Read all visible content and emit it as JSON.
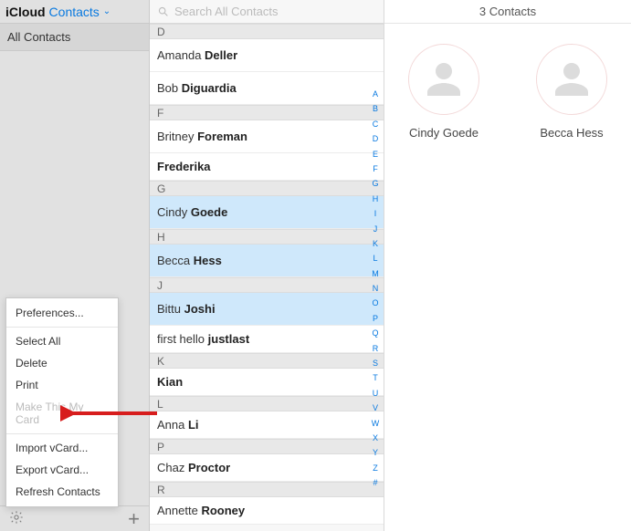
{
  "header": {
    "brand": "iCloud",
    "section": "Contacts"
  },
  "sidebar": {
    "groups": [
      {
        "label": "All Contacts"
      }
    ]
  },
  "search": {
    "placeholder": "Search All Contacts"
  },
  "alpha_index": [
    "A",
    "B",
    "C",
    "D",
    "E",
    "F",
    "G",
    "H",
    "I",
    "J",
    "K",
    "L",
    "M",
    "N",
    "O",
    "P",
    "Q",
    "R",
    "S",
    "T",
    "U",
    "V",
    "W",
    "X",
    "Y",
    "Z",
    "#"
  ],
  "popup": {
    "items": [
      {
        "label": "Preferences...",
        "disabled": false
      },
      {
        "sep": true
      },
      {
        "label": "Select All",
        "disabled": false
      },
      {
        "label": "Delete",
        "disabled": false
      },
      {
        "label": "Print",
        "disabled": false
      },
      {
        "label": "Make This My Card",
        "disabled": true
      },
      {
        "sep": true
      },
      {
        "label": "Import vCard...",
        "disabled": false
      },
      {
        "label": "Export vCard...",
        "disabled": false
      },
      {
        "label": "Refresh Contacts",
        "disabled": false
      }
    ]
  },
  "list": [
    {
      "type": "header",
      "label": "D"
    },
    {
      "type": "contact",
      "first": "Amanda ",
      "last": "Deller",
      "selected": false,
      "slim": false
    },
    {
      "type": "contact",
      "first": "Bob ",
      "last": "Diguardia",
      "selected": false,
      "slim": false
    },
    {
      "type": "header",
      "label": "F"
    },
    {
      "type": "contact",
      "first": "Britney ",
      "last": "Foreman",
      "selected": false,
      "slim": false
    },
    {
      "type": "contact",
      "first": "",
      "last": "Frederika",
      "selected": false,
      "slim": true
    },
    {
      "type": "header",
      "label": "G"
    },
    {
      "type": "contact",
      "first": "Cindy ",
      "last": "Goede",
      "selected": true,
      "slim": false
    },
    {
      "type": "header",
      "label": "H"
    },
    {
      "type": "contact",
      "first": "Becca ",
      "last": "Hess",
      "selected": true,
      "slim": false
    },
    {
      "type": "header",
      "label": "J"
    },
    {
      "type": "contact",
      "first": "Bittu ",
      "last": "Joshi",
      "selected": true,
      "slim": false
    },
    {
      "type": "contact",
      "first": "first hello ",
      "last": "justlast",
      "selected": false,
      "slim": true
    },
    {
      "type": "header",
      "label": "K"
    },
    {
      "type": "contact",
      "first": "",
      "last": "Kian",
      "selected": false,
      "slim": true
    },
    {
      "type": "header",
      "label": "L"
    },
    {
      "type": "contact",
      "first": "Anna ",
      "last": "Li",
      "selected": false,
      "slim": true
    },
    {
      "type": "header",
      "label": "P"
    },
    {
      "type": "contact",
      "first": "Chaz ",
      "last": "Proctor",
      "selected": false,
      "slim": true
    },
    {
      "type": "header",
      "label": "R"
    },
    {
      "type": "contact",
      "first": "Annette ",
      "last": "Rooney",
      "selected": false,
      "slim": true
    }
  ],
  "detail": {
    "count_label": "3 Contacts",
    "cards": [
      {
        "name": "Cindy Goede"
      },
      {
        "name": "Becca Hess"
      }
    ]
  }
}
